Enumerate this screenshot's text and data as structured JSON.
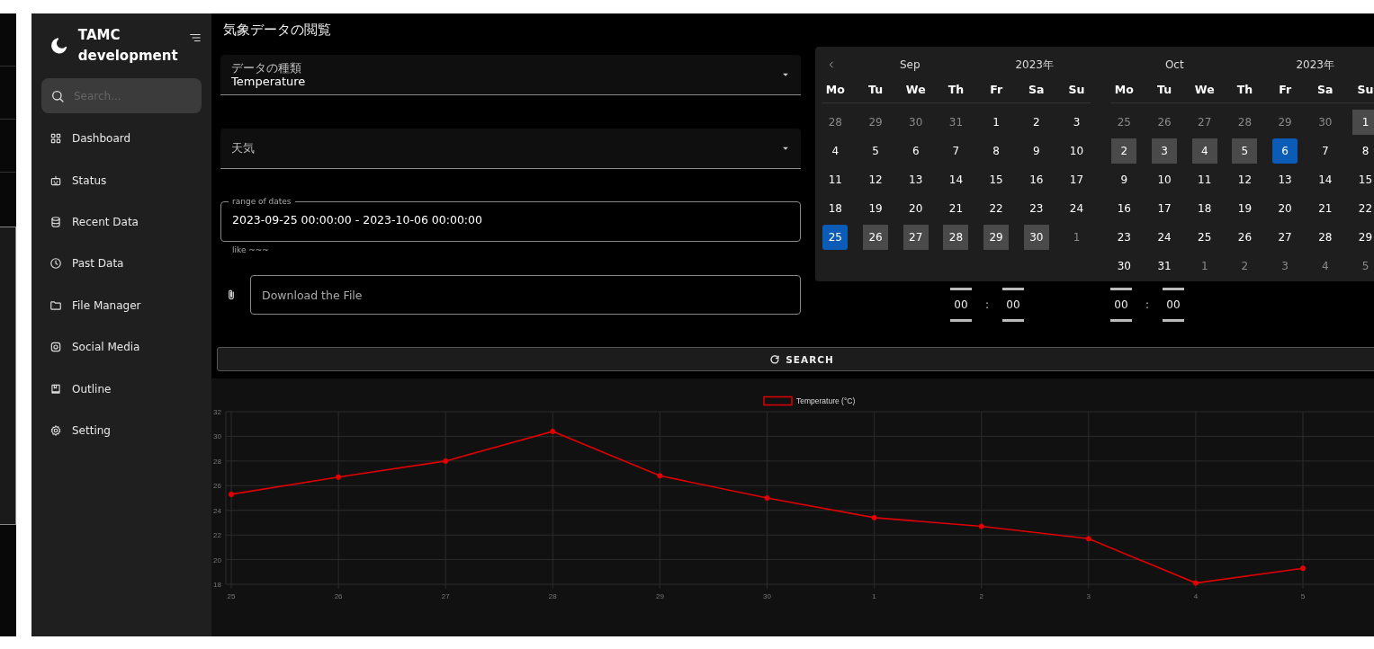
{
  "sidebar": {
    "brand": "TAMC development",
    "search": {
      "placeholder": "Search..."
    },
    "items": [
      {
        "label": "Dashboard"
      },
      {
        "label": "Status"
      },
      {
        "label": "Recent Data"
      },
      {
        "label": "Past Data"
      },
      {
        "label": "File Manager"
      },
      {
        "label": "Social Media"
      },
      {
        "label": "Outline"
      },
      {
        "label": "Setting"
      }
    ]
  },
  "page_title": "気象データの閲覧",
  "form": {
    "data_type": {
      "label": "データの種類",
      "value": "Temperature"
    },
    "weather": {
      "label": "天気"
    },
    "date_range": {
      "label": "range of dates",
      "value": "2023-09-25 00:00:00 - 2023-10-06 00:00:00",
      "helper": "like ~~~"
    },
    "file": {
      "placeholder": "Download the File"
    }
  },
  "date_picker": {
    "months": [
      {
        "month": "Sep",
        "year": "2023年",
        "weekdays": [
          "Mo",
          "Tu",
          "We",
          "Th",
          "Fr",
          "Sa",
          "Su"
        ],
        "weeks": [
          [
            {
              "d": "28",
              "kind": "outside",
              "selected": false
            },
            {
              "d": "29",
              "kind": "outside",
              "selected": false
            },
            {
              "d": "30",
              "kind": "outside",
              "selected": false
            },
            {
              "d": "31",
              "kind": "outside",
              "selected": false
            },
            {
              "d": "1",
              "kind": "day",
              "selected": false
            },
            {
              "d": "2",
              "kind": "day",
              "selected": false
            },
            {
              "d": "3",
              "kind": "day",
              "selected": false
            }
          ],
          [
            {
              "d": "4",
              "kind": "day",
              "selected": false
            },
            {
              "d": "5",
              "kind": "day",
              "selected": false
            },
            {
              "d": "6",
              "kind": "day",
              "selected": false
            },
            {
              "d": "7",
              "kind": "day",
              "selected": false
            },
            {
              "d": "8",
              "kind": "day",
              "selected": false
            },
            {
              "d": "9",
              "kind": "day",
              "selected": false
            },
            {
              "d": "10",
              "kind": "day",
              "selected": false
            }
          ],
          [
            {
              "d": "11",
              "kind": "day",
              "selected": false
            },
            {
              "d": "12",
              "kind": "day",
              "selected": false
            },
            {
              "d": "13",
              "kind": "day",
              "selected": false
            },
            {
              "d": "14",
              "kind": "day",
              "selected": false
            },
            {
              "d": "15",
              "kind": "day",
              "selected": false
            },
            {
              "d": "16",
              "kind": "day",
              "selected": false
            },
            {
              "d": "17",
              "kind": "day",
              "selected": false
            }
          ],
          [
            {
              "d": "18",
              "kind": "day",
              "selected": false
            },
            {
              "d": "19",
              "kind": "day",
              "selected": false
            },
            {
              "d": "20",
              "kind": "day",
              "selected": false
            },
            {
              "d": "21",
              "kind": "day",
              "selected": false
            },
            {
              "d": "22",
              "kind": "day",
              "selected": false
            },
            {
              "d": "23",
              "kind": "day",
              "selected": false
            },
            {
              "d": "24",
              "kind": "day",
              "selected": false
            }
          ],
          [
            {
              "d": "25",
              "kind": "day",
              "selected": true
            },
            {
              "d": "26",
              "kind": "range",
              "selected": false
            },
            {
              "d": "27",
              "kind": "range",
              "selected": false
            },
            {
              "d": "28",
              "kind": "range",
              "selected": false
            },
            {
              "d": "29",
              "kind": "range",
              "selected": false
            },
            {
              "d": "30",
              "kind": "range",
              "selected": false
            },
            {
              "d": "1",
              "kind": "outside",
              "selected": false
            }
          ]
        ]
      },
      {
        "month": "Oct",
        "year": "2023年",
        "weekdays": [
          "Mo",
          "Tu",
          "We",
          "Th",
          "Fr",
          "Sa",
          "Su"
        ],
        "weeks": [
          [
            {
              "d": "25",
              "kind": "outside",
              "selected": false
            },
            {
              "d": "26",
              "kind": "outside",
              "selected": false
            },
            {
              "d": "27",
              "kind": "outside",
              "selected": false
            },
            {
              "d": "28",
              "kind": "outside",
              "selected": false
            },
            {
              "d": "29",
              "kind": "outside",
              "selected": false
            },
            {
              "d": "30",
              "kind": "outside",
              "selected": false
            },
            {
              "d": "1",
              "kind": "range",
              "selected": false
            }
          ],
          [
            {
              "d": "2",
              "kind": "range",
              "selected": false
            },
            {
              "d": "3",
              "kind": "range",
              "selected": false
            },
            {
              "d": "4",
              "kind": "range",
              "selected": false
            },
            {
              "d": "5",
              "kind": "range",
              "selected": false
            },
            {
              "d": "6",
              "kind": "day",
              "selected": true
            },
            {
              "d": "7",
              "kind": "day",
              "selected": false
            },
            {
              "d": "8",
              "kind": "day",
              "selected": false
            }
          ],
          [
            {
              "d": "9",
              "kind": "day",
              "selected": false
            },
            {
              "d": "10",
              "kind": "day",
              "selected": false
            },
            {
              "d": "11",
              "kind": "day",
              "selected": false
            },
            {
              "d": "12",
              "kind": "day",
              "selected": false
            },
            {
              "d": "13",
              "kind": "day",
              "selected": false
            },
            {
              "d": "14",
              "kind": "day",
              "selected": false
            },
            {
              "d": "15",
              "kind": "day",
              "selected": false
            }
          ],
          [
            {
              "d": "16",
              "kind": "day",
              "selected": false
            },
            {
              "d": "17",
              "kind": "day",
              "selected": false
            },
            {
              "d": "18",
              "kind": "day",
              "selected": false
            },
            {
              "d": "19",
              "kind": "day",
              "selected": false
            },
            {
              "d": "20",
              "kind": "day",
              "selected": false
            },
            {
              "d": "21",
              "kind": "day",
              "selected": false
            },
            {
              "d": "22",
              "kind": "day",
              "selected": false
            }
          ],
          [
            {
              "d": "23",
              "kind": "day",
              "selected": false
            },
            {
              "d": "24",
              "kind": "day",
              "selected": false
            },
            {
              "d": "25",
              "kind": "day",
              "selected": false
            },
            {
              "d": "26",
              "kind": "day",
              "selected": false
            },
            {
              "d": "27",
              "kind": "day",
              "selected": false
            },
            {
              "d": "28",
              "kind": "day",
              "selected": false
            },
            {
              "d": "29",
              "kind": "day",
              "selected": false
            }
          ],
          [
            {
              "d": "30",
              "kind": "day",
              "selected": false
            },
            {
              "d": "31",
              "kind": "day",
              "selected": false
            },
            {
              "d": "1",
              "kind": "outside",
              "selected": false
            },
            {
              "d": "2",
              "kind": "outside",
              "selected": false
            },
            {
              "d": "3",
              "kind": "outside",
              "selected": false
            },
            {
              "d": "4",
              "kind": "outside",
              "selected": false
            },
            {
              "d": "5",
              "kind": "outside",
              "selected": false
            }
          ]
        ]
      }
    ]
  },
  "time_pickers": [
    {
      "hours": "00",
      "separator": ":",
      "minutes": "00"
    },
    {
      "hours": "00",
      "separator": ":",
      "minutes": "00"
    }
  ],
  "search_button": "SEARCH",
  "chart": {
    "chart_data": {
      "type": "line",
      "categories": [
        "25",
        "26",
        "27",
        "28",
        "29",
        "30",
        "1",
        "2",
        "3",
        "4",
        "5"
      ],
      "grid": true,
      "series": [
        {
          "name": "Temperature (°C)",
          "color": "#e00000",
          "marker": true,
          "values": [
            25.3,
            26.7,
            28.0,
            30.4,
            26.8,
            25.0,
            23.4,
            22.7,
            21.7,
            18.1,
            19.3
          ]
        }
      ],
      "ylim": [
        18,
        32
      ],
      "yticks": [
        18,
        20,
        22,
        24,
        26,
        28,
        30,
        32
      ]
    }
  }
}
